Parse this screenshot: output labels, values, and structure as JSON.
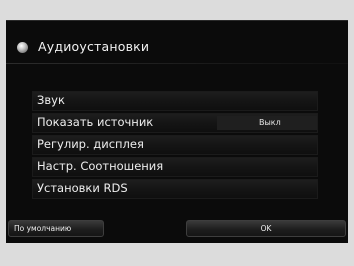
{
  "header": {
    "title": "Аудиоустановки",
    "icon": "circle-bullet-icon"
  },
  "menu": {
    "items": [
      {
        "label": "Звук",
        "value": ""
      },
      {
        "label": "Показать источник",
        "value": "Выкл"
      },
      {
        "label": "Регулир. дисплея",
        "value": ""
      },
      {
        "label": "Настр. Соотношения",
        "value": ""
      },
      {
        "label": "Установки RDS",
        "value": ""
      }
    ]
  },
  "footer": {
    "default_label": "По умолчанию",
    "ok_label": "OK"
  },
  "colors": {
    "background": "#0b0b0b",
    "text": "#eeeeee",
    "frame": "#dcdcdc"
  }
}
